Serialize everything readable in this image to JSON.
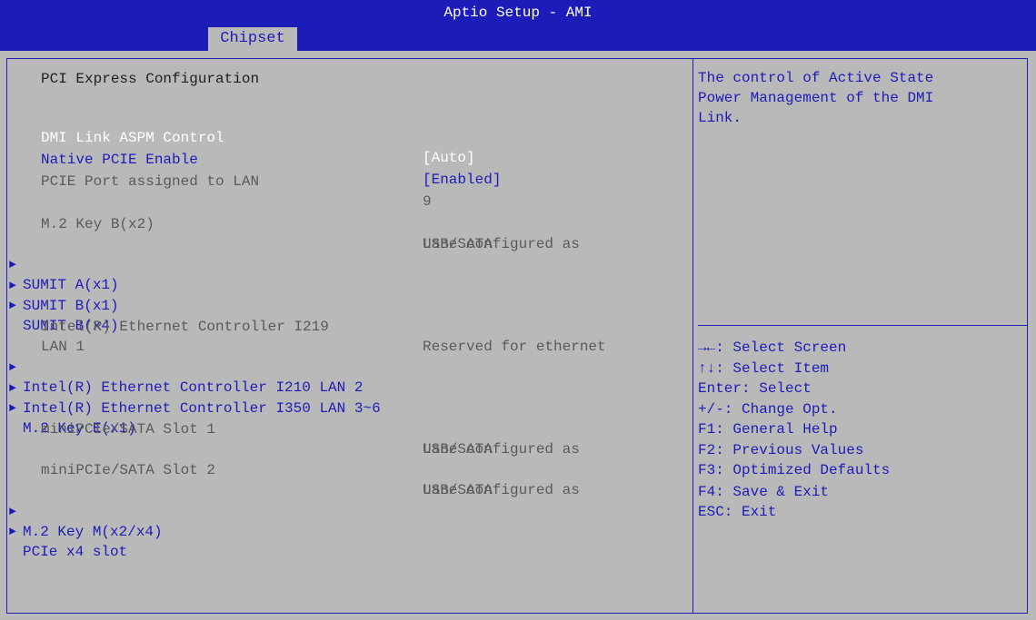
{
  "window": {
    "title": "Aptio Setup - AMI",
    "active_tab": "Chipset"
  },
  "page": {
    "title": "PCI Express Configuration"
  },
  "items": {
    "dmi_aspm": {
      "label": "DMI Link ASPM Control",
      "value": "[Auto]"
    },
    "native_pcie": {
      "label": "Native PCIE Enable",
      "value": "[Enabled]"
    },
    "pcie_lan": {
      "label": "PCIE Port assigned to LAN",
      "value": "9"
    },
    "m2_keyb": {
      "label": "M.2 Key B(x2)",
      "value_line1": "Lane configured as",
      "value_line2": "USB/SATA"
    },
    "sumit_a": {
      "label": "SUMIT A(x1)"
    },
    "sumit_b1": {
      "label": "SUMIT B(x1)"
    },
    "sumit_b4": {
      "label": "SUMIT B(x4)"
    },
    "i219": {
      "label_line1": "Intel(R) Ethernet Controller I219",
      "label_line2": "LAN 1",
      "value": "Reserved for ethernet"
    },
    "i210": {
      "label": "Intel(R) Ethernet Controller I210 LAN 2"
    },
    "i350": {
      "label": "Intel(R) Ethernet Controller I350 LAN 3~6"
    },
    "m2_keye": {
      "label": "M.2 Key E(x1)"
    },
    "minipcie1": {
      "label": "miniPCIe/SATA Slot 1",
      "value_line1": "Lane configured as",
      "value_line2": "USB/SATA"
    },
    "minipcie2": {
      "label": "miniPCIe/SATA Slot 2",
      "value_line1": "Lane configured as",
      "value_line2": "USB/SATA"
    },
    "m2_keym": {
      "label": "M.2 Key M(x2/x4)"
    },
    "pcie_x4": {
      "label": "PCIe x4 slot"
    },
    "submenu_arrow": "►"
  },
  "help": {
    "text": "The control of Active State\nPower Management of the DMI\nLink."
  },
  "keys": [
    "→←: Select Screen",
    "↑↓: Select Item",
    "Enter: Select",
    "+/-: Change Opt.",
    "F1: General Help",
    "F2: Previous Values",
    "F3: Optimized Defaults",
    "F4: Save & Exit",
    "ESC: Exit"
  ],
  "colors": {
    "background": "#b9b9b9",
    "header": "#1c1cb8",
    "accent_text": "#1c1cb8",
    "selected_text": "#ffffff",
    "disabled_text": "#5a5a5a"
  }
}
